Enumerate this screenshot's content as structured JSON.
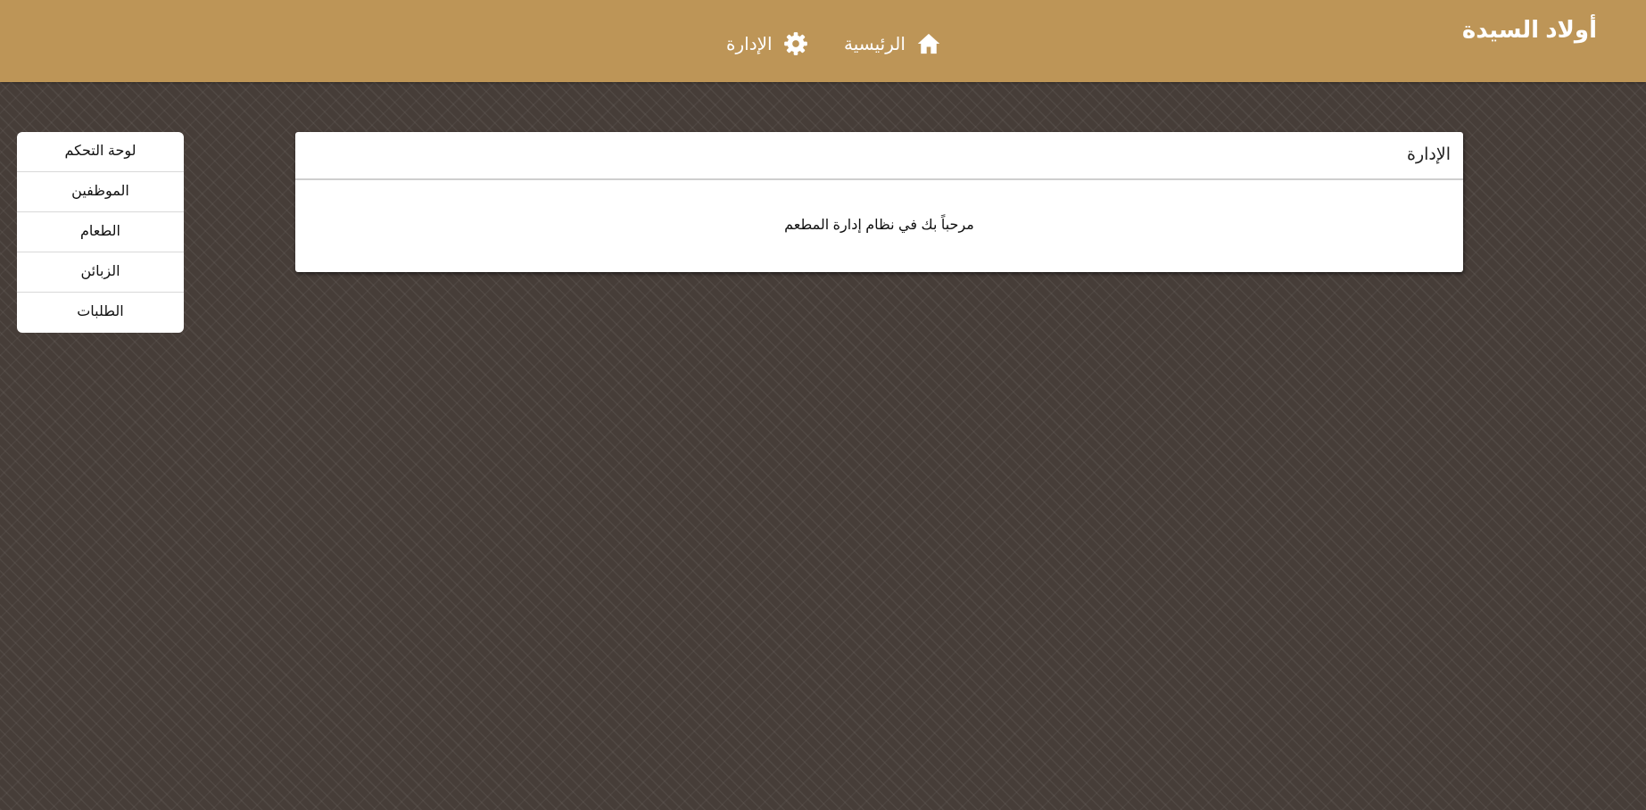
{
  "header": {
    "brand": "أولاد السيدة",
    "nav": {
      "home_label": "الرئيسية",
      "home_icon": "home-icon",
      "admin_label": "الإدارة",
      "admin_icon": "gear-icon"
    },
    "color": "#bd9557"
  },
  "sidebar": {
    "items": [
      {
        "label": "لوحة التحكم"
      },
      {
        "label": "الموظفين"
      },
      {
        "label": "الطعام"
      },
      {
        "label": "الزبائن"
      },
      {
        "label": "الطلبات"
      }
    ]
  },
  "main": {
    "panel_title": "الإدارة",
    "welcome_text": "مرحباً بك في نظام إدارة المطعم"
  },
  "colors": {
    "background": "#463d38",
    "accent": "#bd9557"
  }
}
